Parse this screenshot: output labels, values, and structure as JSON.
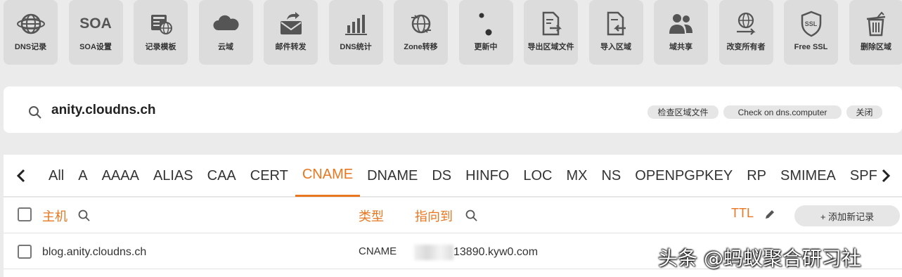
{
  "toolbar": [
    {
      "label": "DNS记录",
      "icon": "globe-icon"
    },
    {
      "label": "SOA设置",
      "icon": "soa-text-icon"
    },
    {
      "label": "记录模板",
      "icon": "template-icon"
    },
    {
      "label": "云域",
      "icon": "cloud-icon"
    },
    {
      "label": "邮件转发",
      "icon": "mail-forward-icon"
    },
    {
      "label": "DNS统计",
      "icon": "bar-chart-icon"
    },
    {
      "label": "Zone转移",
      "icon": "globe-transfer-icon"
    },
    {
      "label": "更新中",
      "icon": "dots-icon"
    },
    {
      "label": "导出区域文件",
      "icon": "export-file-icon"
    },
    {
      "label": "导入区域",
      "icon": "import-file-icon"
    },
    {
      "label": "域共享",
      "icon": "users-icon"
    },
    {
      "label": "改变所有者",
      "icon": "change-owner-icon"
    },
    {
      "label": "Free SSL",
      "icon": "ssl-shield-icon"
    },
    {
      "label": "删除区域",
      "icon": "trash-icon"
    }
  ],
  "soa_icon_text": "SOA",
  "ssl_icon_text": "SSL",
  "zone": {
    "name": "anity.cloudns.ch",
    "buttons": [
      "检查区域文件",
      "Check on dns.computer",
      "关闭"
    ]
  },
  "tabs": [
    "All",
    "A",
    "AAAA",
    "ALIAS",
    "CAA",
    "CERT",
    "CNAME",
    "DNAME",
    "DS",
    "HINFO",
    "LOC",
    "MX",
    "NS",
    "OPENPGPKEY",
    "RP",
    "SMIMEA",
    "SPF"
  ],
  "active_tab": "CNAME",
  "table": {
    "col_host": "主机",
    "col_type": "类型",
    "col_points_to": "指向到",
    "col_ttl": "TTL",
    "add_button": "+ 添加新记录",
    "rows": [
      {
        "host": "blog.anity.cloudns.ch",
        "type": "CNAME",
        "points_to": "13890.kyw0.com"
      }
    ]
  },
  "watermark": "头条 @蚂蚁聚合研习社",
  "colors": {
    "accent": "#e87722",
    "icon": "#555555",
    "tile": "#dcdcdc"
  }
}
